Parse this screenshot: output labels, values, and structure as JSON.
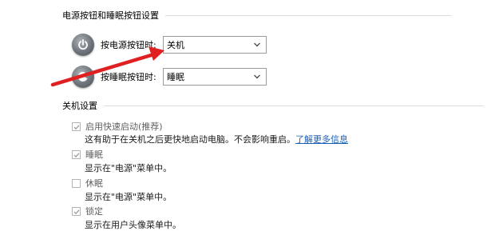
{
  "sections": {
    "power_buttons_header": "电源按钮和睡眠按钮设置",
    "shutdown_header": "关机设置"
  },
  "power_button": {
    "label": "按电源按钮时:",
    "value": "关机"
  },
  "sleep_button": {
    "label": "按睡眠按钮时:",
    "value": "睡眠"
  },
  "options": {
    "fast_startup": {
      "label": "启用快速启动(推荐)",
      "description": "这有助于在关机之后更快地启动电脑。不会影响重启。",
      "link": "了解更多信息",
      "checked": true
    },
    "sleep": {
      "label": "睡眠",
      "description": "显示在\"电源\"菜单中。",
      "checked": true
    },
    "hibernate": {
      "label": "休眠",
      "description": "显示在\"电源\"菜单中。",
      "checked": false
    },
    "lock": {
      "label": "锁定",
      "description": "显示在用户头像菜单中。",
      "checked": true
    }
  },
  "annotation": {
    "arrow_color": "#e02020"
  }
}
